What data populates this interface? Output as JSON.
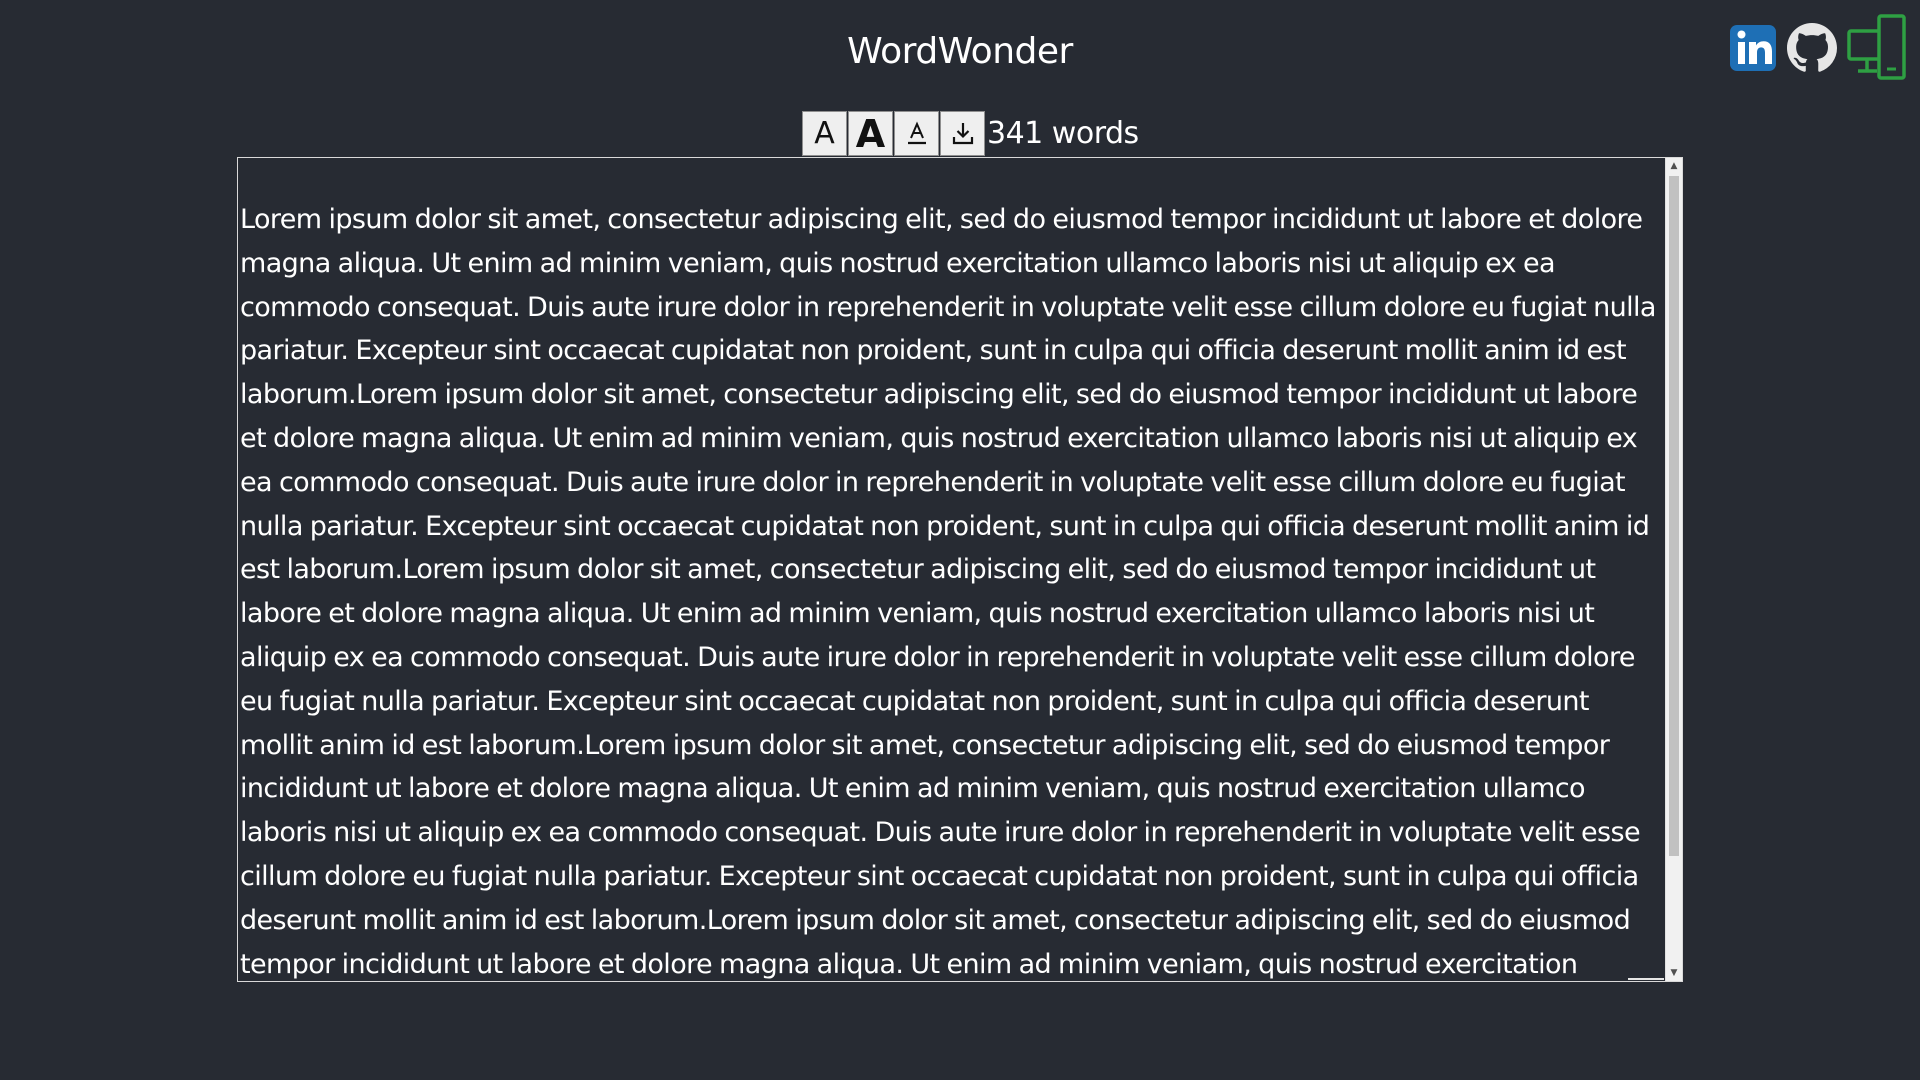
{
  "header": {
    "title": "WordWonder"
  },
  "social": {
    "linkedin_icon": "linkedin-icon",
    "github_icon": "github-icon",
    "devices_icon": "devices-icon",
    "colors": {
      "linkedin": "#1e6fb5",
      "github": "#e6e6e6",
      "devices": "#2ea043"
    }
  },
  "toolbar": {
    "decrease_font_glyph": "A",
    "increase_font_glyph": "A",
    "text_color_icon": "text-color-icon",
    "download_icon": "download-icon",
    "word_count": "341 words"
  },
  "editor": {
    "text": "Lorem ipsum dolor sit amet, consectetur adipiscing elit, sed do eiusmod tempor incididunt ut labore et dolore magna aliqua. Ut enim ad minim veniam, quis nostrud exercitation ullamco laboris nisi ut aliquip ex ea commodo consequat. Duis aute irure dolor in reprehenderit in voluptate velit esse cillum dolore eu fugiat nulla pariatur. Excepteur sint occaecat cupidatat non proident, sunt in culpa qui officia deserunt mollit anim id est laborum.Lorem ipsum dolor sit amet, consectetur adipiscing elit, sed do eiusmod tempor incididunt ut labore et dolore magna aliqua. Ut enim ad minim veniam, quis nostrud exercitation ullamco laboris nisi ut aliquip ex ea commodo consequat. Duis aute irure dolor in reprehenderit in voluptate velit esse cillum dolore eu fugiat nulla pariatur. Excepteur sint occaecat cupidatat non proident, sunt in culpa qui officia deserunt mollit anim id est laborum.Lorem ipsum dolor sit amet, consectetur adipiscing elit, sed do eiusmod tempor incididunt ut labore et dolore magna aliqua. Ut enim ad minim veniam, quis nostrud exercitation ullamco laboris nisi ut aliquip ex ea commodo consequat. Duis aute irure dolor in reprehenderit in voluptate velit esse cillum dolore eu fugiat nulla pariatur. Excepteur sint occaecat cupidatat non proident, sunt in culpa qui officia deserunt mollit anim id est laborum.Lorem ipsum dolor sit amet, consectetur adipiscing elit, sed do eiusmod tempor incididunt ut labore et dolore magna aliqua. Ut enim ad minim veniam, quis nostrud exercitation ullamco laboris nisi ut aliquip ex ea commodo consequat. Duis aute irure dolor in reprehenderit in voluptate velit esse cillum dolore eu fugiat nulla pariatur. Excepteur sint occaecat cupidatat non proident, sunt in culpa qui officia deserunt mollit anim id est laborum.Lorem ipsum dolor sit amet, consectetur adipiscing elit, sed do eiusmod tempor incididunt ut labore et dolore magna aliqua. Ut enim ad minim veniam, quis nostrud exercitation"
  },
  "theme": {
    "background": "#272b33",
    "text": "#ffffff",
    "button_bg": "#efefef"
  }
}
